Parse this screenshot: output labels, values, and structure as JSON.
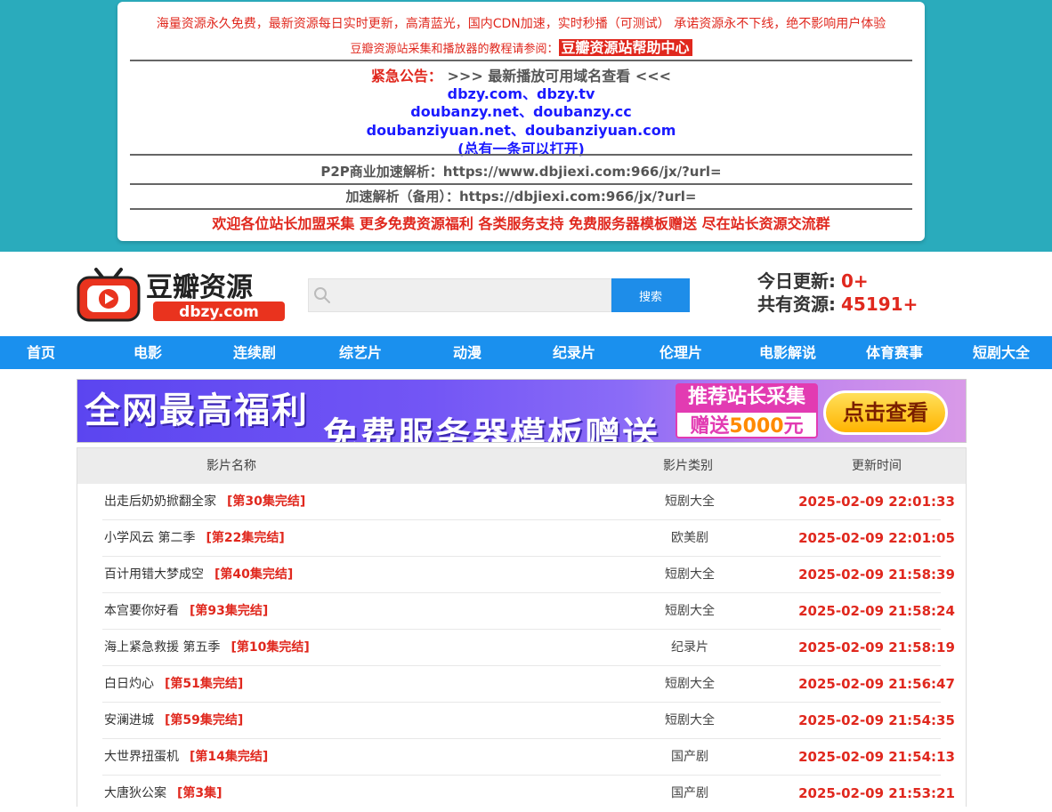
{
  "notice": {
    "line1": "海量资源永久免费，最新资源每日实时更新，高清蓝光，国内CDN加速，实时秒播（可测试） 承诺资源永不下线，绝不影响用户体验",
    "line2_prefix": "豆瓣资源站采集和播放器的教程请参阅：",
    "help_link": "豆瓣资源站帮助中心",
    "urgent_label": "紧急公告：",
    "urgent_text": ">>> 最新播放可用域名查看 <<<",
    "domains": [
      "dbzy.com、dbzy.tv",
      "doubanzy.net、doubanzy.cc",
      "doubanziyuan.net、doubanziyuan.com"
    ],
    "domains_note": "(总有一条可以打开)",
    "p2p": "P2P商业加速解析：https://www.dbjiexi.com:966/jx/?url=",
    "backup": "加速解析（备用）：https://dbjiexi.com:966/jx/?url=",
    "welcome": "欢迎各位站长加盟采集 更多免费资源福利 各类服务支持 免费服务器模板赠送 尽在站长资源交流群"
  },
  "header": {
    "logo_cn": "豆瓣资源",
    "logo_en": "dbzy.com",
    "search_placeholder": "",
    "search_button": "搜索",
    "today_label": "今日更新:",
    "today_value": "0+",
    "total_label": "共有资源:",
    "total_value": "45191+"
  },
  "nav": [
    "首页",
    "电影",
    "连续剧",
    "综艺片",
    "动漫",
    "纪录片",
    "伦理片",
    "电影解说",
    "体育赛事",
    "短剧大全"
  ],
  "ad": {
    "text1": "全网最高福利",
    "text2": "免费服务器模板赠送",
    "tag_top": "推荐站长采集",
    "tag_bottom_prefix": "赠送",
    "tag_bottom_amount": "5000",
    "tag_bottom_suffix": "元",
    "cta": "点击查看"
  },
  "table": {
    "headers": [
      "影片名称",
      "影片类别",
      "更新时间"
    ],
    "rows": [
      {
        "title": "出走后奶奶掀翻全家",
        "ep": "[第30集完结]",
        "type": "短剧大全",
        "time": "2025-02-09 22:01:33"
      },
      {
        "title": "小学风云 第二季",
        "ep": "[第22集完结]",
        "type": "欧美剧",
        "time": "2025-02-09 22:01:05"
      },
      {
        "title": "百计用错大梦成空",
        "ep": "[第40集完结]",
        "type": "短剧大全",
        "time": "2025-02-09 21:58:39"
      },
      {
        "title": "本宫要你好看",
        "ep": "[第93集完结]",
        "type": "短剧大全",
        "time": "2025-02-09 21:58:24"
      },
      {
        "title": "海上紧急救援 第五季",
        "ep": "[第10集完结]",
        "type": "纪录片",
        "time": "2025-02-09 21:58:19"
      },
      {
        "title": "白日灼心",
        "ep": "[第51集完结]",
        "type": "短剧大全",
        "time": "2025-02-09 21:56:47"
      },
      {
        "title": "安澜进城",
        "ep": "[第59集完结]",
        "type": "短剧大全",
        "time": "2025-02-09 21:54:35"
      },
      {
        "title": "大世界扭蛋机",
        "ep": "[第14集完结]",
        "type": "国产剧",
        "time": "2025-02-09 21:54:13"
      },
      {
        "title": "大唐狄公案",
        "ep": "[第3集]",
        "type": "国产剧",
        "time": "2025-02-09 21:53:21"
      }
    ]
  },
  "colors": {
    "teal_band": "#2aabbc",
    "nav_blue": "#1a90ee",
    "accent_red": "#e0281e",
    "search_blue": "#1e8de9"
  }
}
